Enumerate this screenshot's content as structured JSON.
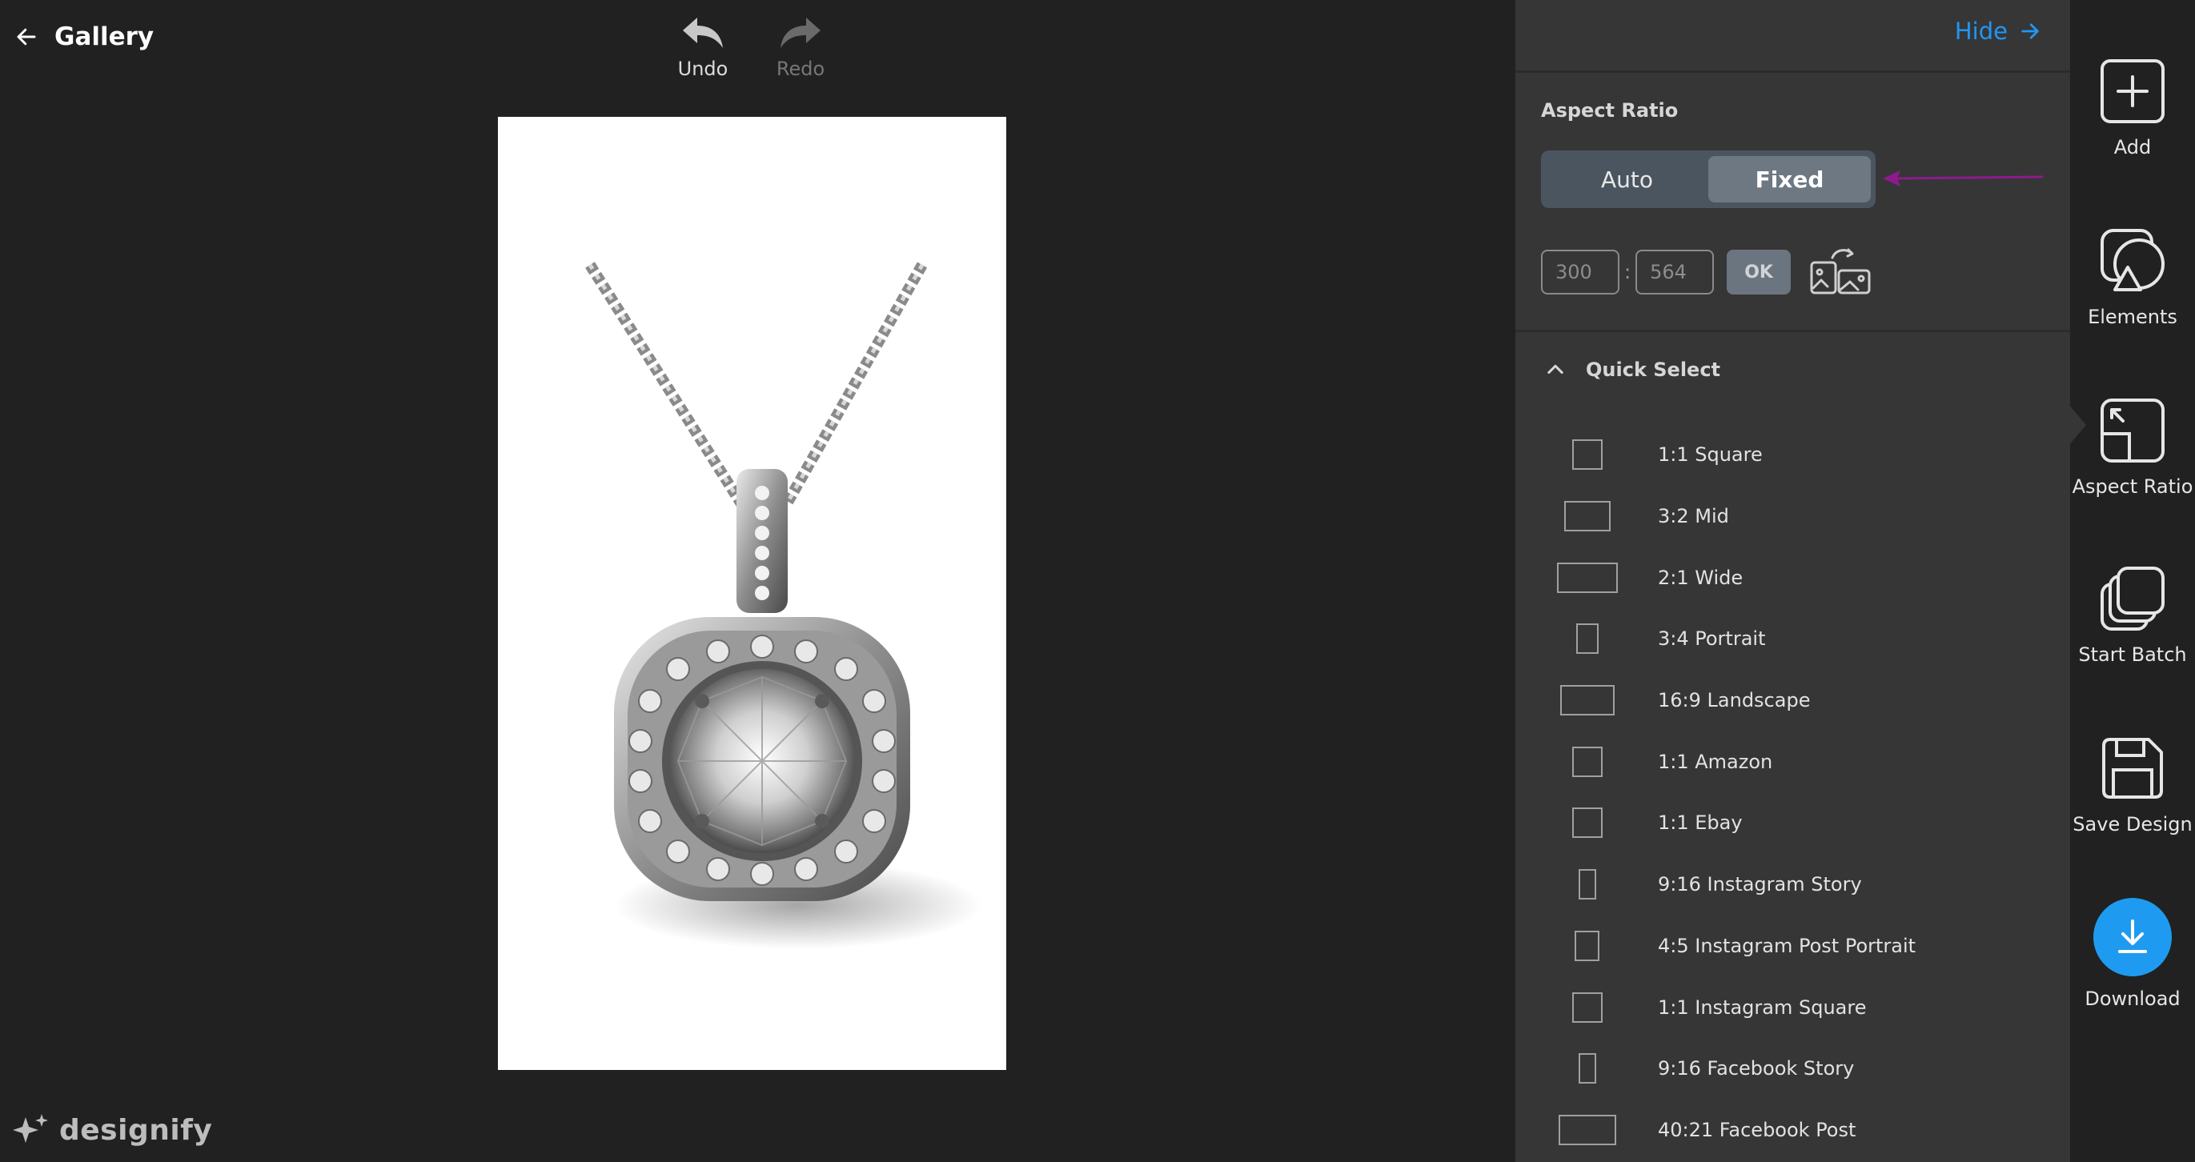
{
  "header": {
    "back_label": "Gallery",
    "undo_label": "Undo",
    "redo_label": "Redo"
  },
  "brand": {
    "name": "designify"
  },
  "panel": {
    "hide_label": "Hide",
    "aspect_ratio_title": "Aspect Ratio",
    "mode_auto": "Auto",
    "mode_fixed": "Fixed",
    "selected_mode": "Fixed",
    "width_value": "300",
    "height_value": "564",
    "separator": ":",
    "ok_label": "OK",
    "quick_select_title": "Quick Select",
    "quick_select_items": [
      {
        "label": "1:1 Square"
      },
      {
        "label": "3:2 Mid"
      },
      {
        "label": "2:1 Wide"
      },
      {
        "label": "3:4 Portrait"
      },
      {
        "label": "16:9 Landscape"
      },
      {
        "label": "1:1 Amazon"
      },
      {
        "label": "1:1 Ebay"
      },
      {
        "label": "9:16 Instagram Story"
      },
      {
        "label": "4:5 Instagram Post Portrait"
      },
      {
        "label": "1:1 Instagram Square"
      },
      {
        "label": "9:16 Facebook Story"
      },
      {
        "label": "40:21 Facebook Post"
      }
    ]
  },
  "toolbar": {
    "items": [
      {
        "label": "Add",
        "icon": "plus-square-icon"
      },
      {
        "label": "Elements",
        "icon": "shapes-icon"
      },
      {
        "label": "Aspect Ratio",
        "icon": "aspect-ratio-icon"
      },
      {
        "label": "Start Batch",
        "icon": "layers-icon"
      },
      {
        "label": "Save Design",
        "icon": "save-icon"
      },
      {
        "label": "Download",
        "icon": "download-icon"
      }
    ],
    "active": "Aspect Ratio"
  },
  "colors": {
    "background": "#212121",
    "panel": "#363636",
    "accent": "#2196f3",
    "annotation_arrow": "#8e1a8e"
  }
}
